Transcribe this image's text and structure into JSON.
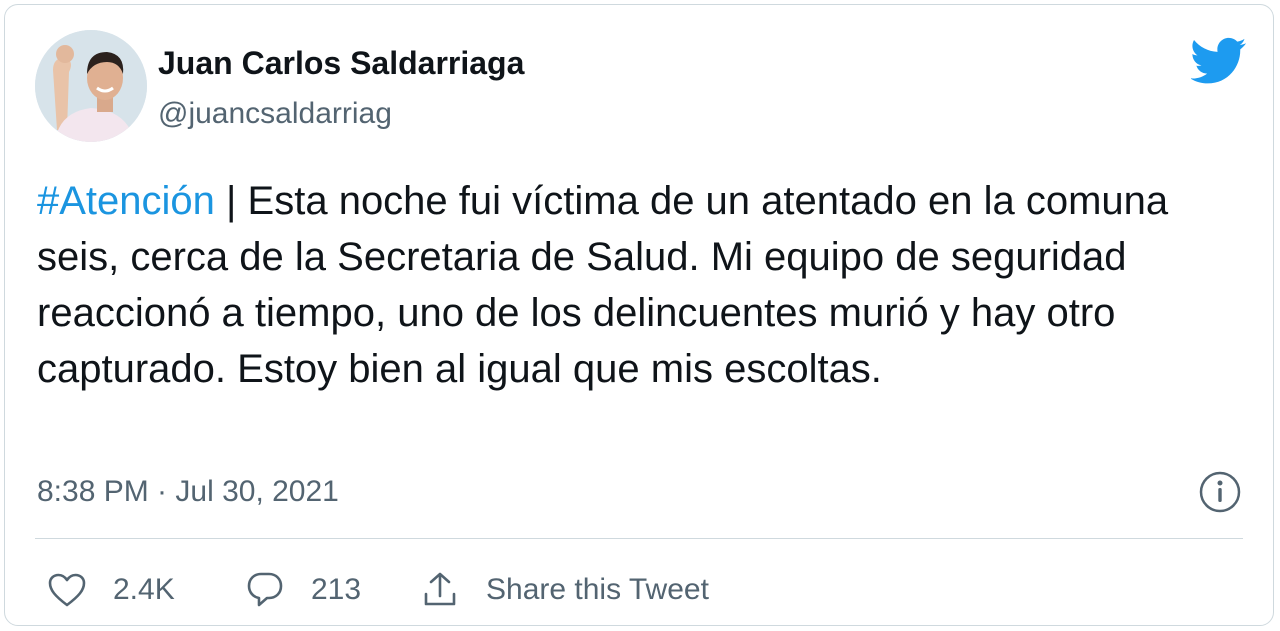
{
  "author": {
    "name": "Juan Carlos Saldarriaga",
    "handle": "@juancsaldarriag"
  },
  "tweet": {
    "hashtag": "#Atención",
    "body": " | Esta noche fui víctima de un atentado en la comuna seis, cerca de la Secretaria de Salud. Mi equipo de seguridad reaccionó a tiempo, uno de los delincuentes murió y hay otro capturado. Estoy bien al igual que mis escoltas.",
    "timestamp": "8:38 PM · Jul 30, 2021"
  },
  "actions": {
    "likes": "2.4K",
    "replies": "213",
    "share_label": "Share this Tweet"
  },
  "icons": {
    "brand": "twitter-bird-icon",
    "info": "info-icon",
    "like": "heart-icon",
    "reply": "speech-bubble-icon",
    "share": "share-icon"
  },
  "colors": {
    "brand": "#1d9bf0",
    "hashtag": "#1b95e0",
    "secondary_text": "#536471",
    "divider": "#cfd9de"
  }
}
